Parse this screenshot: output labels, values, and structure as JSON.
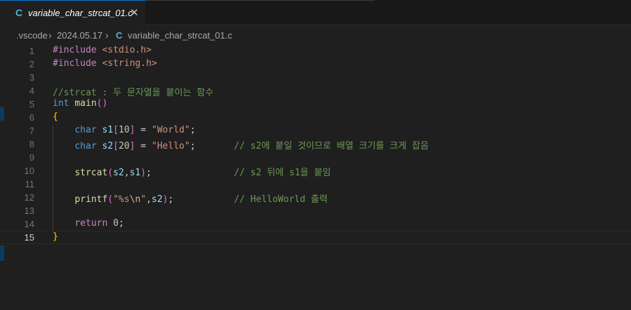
{
  "tab": {
    "icon": "C",
    "title": "variable_char_strcat_01.c",
    "close_symbol": "✕"
  },
  "breadcrumb": {
    "items": [
      ".vscode",
      "2024.05.17"
    ],
    "file_icon": "C",
    "file": "variable_char_strcat_01.c",
    "separator": "›"
  },
  "editor": {
    "current_line": 15,
    "lines": [
      {
        "n": "1",
        "tokens": [
          {
            "t": "#include ",
            "c": "kw"
          },
          {
            "t": "<stdio.h>",
            "c": "str"
          }
        ]
      },
      {
        "n": "2",
        "tokens": [
          {
            "t": "#include ",
            "c": "kw"
          },
          {
            "t": "<string.h>",
            "c": "str"
          }
        ]
      },
      {
        "n": "3",
        "tokens": []
      },
      {
        "n": "4",
        "tokens": [
          {
            "t": "//strcat : 두 문자열을 붙이는 함수",
            "c": "cm"
          }
        ]
      },
      {
        "n": "5",
        "tokens": [
          {
            "t": "int ",
            "c": "type"
          },
          {
            "t": "main",
            "c": "fn"
          },
          {
            "t": "()",
            "c": "br2"
          }
        ]
      },
      {
        "n": "6",
        "tokens": [
          {
            "t": "{",
            "c": "br"
          }
        ]
      },
      {
        "n": "7",
        "tokens": [
          {
            "t": "    ",
            "c": "plain"
          },
          {
            "t": "char ",
            "c": "type"
          },
          {
            "t": "s1",
            "c": "var"
          },
          {
            "t": "[",
            "c": "br2"
          },
          {
            "t": "10",
            "c": "num"
          },
          {
            "t": "]",
            "c": "br2"
          },
          {
            "t": " = ",
            "c": "plain"
          },
          {
            "t": "\"World\"",
            "c": "str"
          },
          {
            "t": ";",
            "c": "plain"
          }
        ]
      },
      {
        "n": "8",
        "tokens": [
          {
            "t": "    ",
            "c": "plain"
          },
          {
            "t": "char ",
            "c": "type"
          },
          {
            "t": "s2",
            "c": "var"
          },
          {
            "t": "[",
            "c": "br2"
          },
          {
            "t": "20",
            "c": "num"
          },
          {
            "t": "]",
            "c": "br2"
          },
          {
            "t": " = ",
            "c": "plain"
          },
          {
            "t": "\"Hello\"",
            "c": "str"
          },
          {
            "t": ";       ",
            "c": "plain"
          },
          {
            "t": "// s2에 붙일 것이므로 배열 크기를 크게 잡음",
            "c": "cm"
          }
        ]
      },
      {
        "n": "9",
        "tokens": []
      },
      {
        "n": "10",
        "tokens": [
          {
            "t": "    ",
            "c": "plain"
          },
          {
            "t": "strcat",
            "c": "fn"
          },
          {
            "t": "(",
            "c": "br2"
          },
          {
            "t": "s2",
            "c": "var"
          },
          {
            "t": ",",
            "c": "plain"
          },
          {
            "t": "s1",
            "c": "var"
          },
          {
            "t": ")",
            "c": "br2"
          },
          {
            "t": ";               ",
            "c": "plain"
          },
          {
            "t": "// s2 뒤에 s1을 붙임",
            "c": "cm"
          }
        ]
      },
      {
        "n": "11",
        "tokens": []
      },
      {
        "n": "12",
        "tokens": [
          {
            "t": "    ",
            "c": "plain"
          },
          {
            "t": "printf",
            "c": "fn"
          },
          {
            "t": "(",
            "c": "br2"
          },
          {
            "t": "\"%s",
            "c": "str"
          },
          {
            "t": "\\n",
            "c": "esc"
          },
          {
            "t": "\"",
            "c": "str"
          },
          {
            "t": ",",
            "c": "plain"
          },
          {
            "t": "s2",
            "c": "var"
          },
          {
            "t": ")",
            "c": "br2"
          },
          {
            "t": ";           ",
            "c": "plain"
          },
          {
            "t": "// HelloWorld 출력",
            "c": "cm"
          }
        ]
      },
      {
        "n": "13",
        "tokens": []
      },
      {
        "n": "14",
        "tokens": [
          {
            "t": "    ",
            "c": "plain"
          },
          {
            "t": "return ",
            "c": "kw"
          },
          {
            "t": "0",
            "c": "num"
          },
          {
            "t": ";",
            "c": "plain"
          }
        ]
      },
      {
        "n": "15",
        "tokens": [
          {
            "t": "}",
            "c": "br"
          }
        ]
      }
    ]
  }
}
